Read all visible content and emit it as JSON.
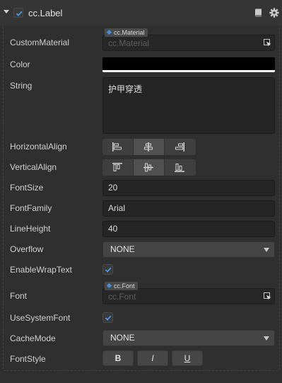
{
  "component": {
    "title": "cc.Label",
    "enabled": true
  },
  "icons": {
    "collapse": "caret-down-icon",
    "help": "book-icon",
    "settings": "gear-icon",
    "asset_picker": "asset-picker-icon"
  },
  "colors": {
    "checkbox_accent": "#4a9ae6",
    "asset_tag_diamond": "#4b8fd6",
    "color_value": "#000000"
  },
  "props": {
    "custom_material": {
      "label": "CustomMaterial",
      "tag": "cc.Material",
      "value": "cc.Material"
    },
    "color": {
      "label": "Color"
    },
    "string": {
      "label": "String",
      "value": "护甲穿透"
    },
    "horizontal_align": {
      "label": "HorizontalAlign",
      "options": [
        "left",
        "center",
        "right"
      ],
      "selected": "center"
    },
    "vertical_align": {
      "label": "VerticalAlign",
      "options": [
        "top",
        "center",
        "bottom"
      ],
      "selected": "center"
    },
    "font_size": {
      "label": "FontSize",
      "value": "20"
    },
    "font_family": {
      "label": "FontFamily",
      "value": "Arial"
    },
    "line_height": {
      "label": "LineHeight",
      "value": "40"
    },
    "overflow": {
      "label": "Overflow",
      "value": "NONE"
    },
    "enable_wrap_text": {
      "label": "EnableWrapText",
      "checked": true
    },
    "font": {
      "label": "Font",
      "tag": "cc.Font",
      "value": "cc.Font"
    },
    "use_system_font": {
      "label": "UseSystemFont",
      "checked": true
    },
    "cache_mode": {
      "label": "CacheMode",
      "value": "NONE"
    },
    "font_style": {
      "label": "FontStyle",
      "bold": "B",
      "italic": "I",
      "underline": "U"
    }
  }
}
